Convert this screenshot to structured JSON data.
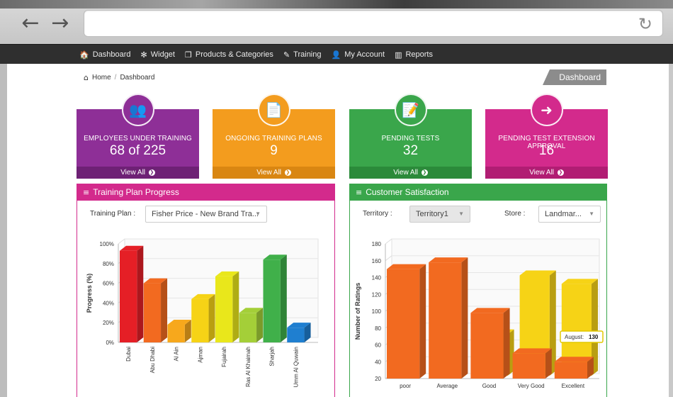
{
  "browser": {
    "back_icon": "←",
    "forward_icon": "→",
    "reload_icon": "↻"
  },
  "nav": {
    "items": [
      {
        "icon": "home-icon",
        "glyph": "🏠",
        "label": "Dashboard"
      },
      {
        "icon": "gear-icon",
        "glyph": "✻",
        "label": "Widget"
      },
      {
        "icon": "box-icon",
        "glyph": "❒",
        "label": "Products & Categories"
      },
      {
        "icon": "edit-icon",
        "glyph": "✎",
        "label": "Training"
      },
      {
        "icon": "user-icon",
        "glyph": "👤",
        "label": "My Account"
      },
      {
        "icon": "bar-chart-icon",
        "glyph": "▥",
        "label": "Reports"
      }
    ]
  },
  "breadcrumb": {
    "home": "Home",
    "separator": "/",
    "current": "Dashboard",
    "badge": "Dashboard"
  },
  "cards": [
    {
      "label": "EMPLOYEES UNDER TRAINING",
      "value": "68 of 225",
      "link": "View All",
      "color": "#8e2f97",
      "foot_color": "#6e2175",
      "icon": "users-icon",
      "glyph": "👥"
    },
    {
      "label": "ONGOING TRAINING PLANS",
      "value": "9",
      "link": "View All",
      "color": "#f39c1e",
      "foot_color": "#d98612",
      "icon": "document-icon",
      "glyph": "📄"
    },
    {
      "label": "PENDING TESTS",
      "value": "32",
      "link": "View All",
      "color": "#3aa64b",
      "foot_color": "#2b8a3a",
      "icon": "test-icon",
      "glyph": "📝"
    },
    {
      "label": "PENDING TEST EXTENSION APPROVAL",
      "value": "16",
      "link": "View All",
      "color": "#d32a8c",
      "foot_color": "#b11d73",
      "icon": "extension-icon",
      "glyph": "➜"
    }
  ],
  "training_panel": {
    "title": "Training Plan Progress",
    "color": "#d32a8c",
    "filter_label": "Training Plan :",
    "filter_value": "Fisher Price - New Brand Tra...",
    "chart_data": {
      "type": "bar",
      "categories": [
        "Dubai",
        "Abu Dhabi",
        "Al Ain",
        "Ajman",
        "Fujairah",
        "Ras Al Khaimah",
        "Sharjah",
        "Umm Al Quwain"
      ],
      "values": [
        93,
        60,
        18,
        44,
        67,
        30,
        84,
        15
      ],
      "colors": [
        "#e51f26",
        "#f26a20",
        "#f7a81c",
        "#f6d316",
        "#e9e71b",
        "#a4cf38",
        "#40b04a",
        "#1f7fd0"
      ],
      "ylabel": "Progress (%)",
      "yticks": [
        "0%",
        "20%",
        "40%",
        "60%",
        "80%",
        "100%"
      ],
      "ylim": [
        0,
        100
      ]
    }
  },
  "satisfaction_panel": {
    "title": "Customer Satisfaction",
    "color": "#3aa64b",
    "territory_label": "Territory :",
    "territory_value": "Territory1",
    "store_label": "Store :",
    "store_value": "Landmar...",
    "tooltip": {
      "label": "August:",
      "value": "130"
    },
    "chart_data": {
      "type": "bar",
      "categories": [
        "poor",
        "Average",
        "Good",
        "Very Good",
        "Excellent"
      ],
      "series": [
        {
          "values": [
            null,
            null,
            70,
            140,
            130
          ],
          "color": "#f6d316"
        },
        {
          "values": [
            150,
            158,
            98,
            50,
            40
          ],
          "color": "#f26a20"
        }
      ],
      "ylabel": "Number of Ratings",
      "yticks": [
        20,
        40,
        60,
        80,
        100,
        120,
        140,
        160,
        180
      ],
      "ylim": [
        20,
        180
      ]
    }
  }
}
